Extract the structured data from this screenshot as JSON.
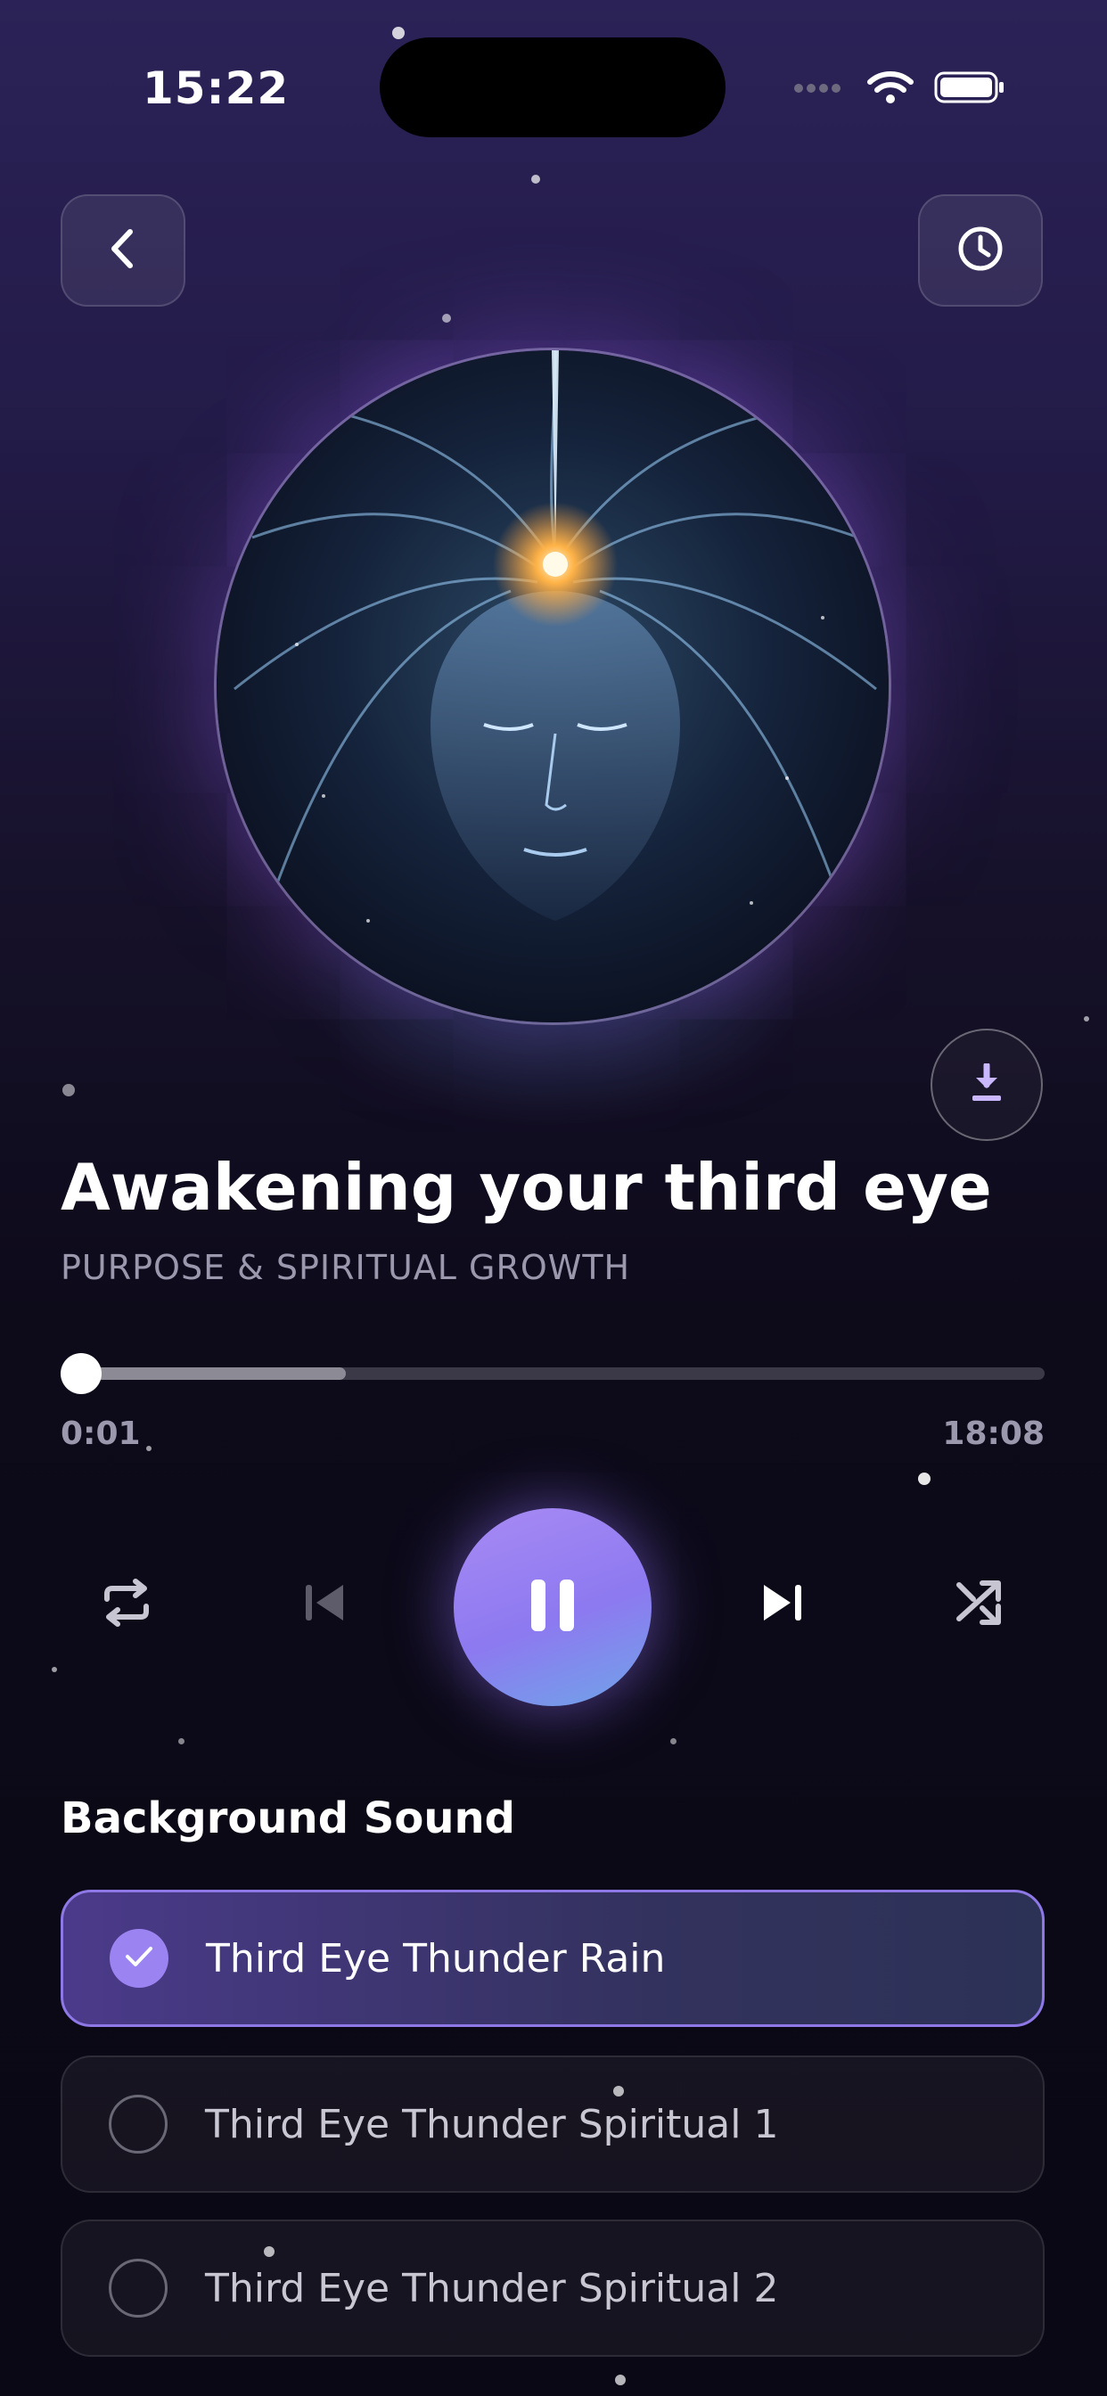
{
  "status_bar": {
    "time": "15:22"
  },
  "track": {
    "title": "Awakening your third eye",
    "category": "PURPOSE & SPIRITUAL GROWTH",
    "elapsed": "0:01",
    "duration": "18:08",
    "buffered_fraction": 0.29,
    "progress_fraction": 0.0
  },
  "background_sound": {
    "heading": "Background Sound",
    "options": [
      {
        "label": "Third Eye Thunder Rain",
        "selected": true
      },
      {
        "label": "Third Eye Thunder Spiritual 1",
        "selected": false
      },
      {
        "label": "Third Eye Thunder Spiritual 2",
        "selected": false
      }
    ]
  },
  "icons": {
    "back": "chevron-left-icon",
    "timer": "clock-icon",
    "download": "download-icon",
    "repeat": "repeat-icon",
    "previous": "skip-previous-icon",
    "play_state": "pause-icon",
    "next": "skip-next-icon",
    "shuffle": "shuffle-icon"
  },
  "colors": {
    "accent": "#9b84f2",
    "play_gradient_start": "#a88bf4",
    "play_gradient_end": "#6fa4e8",
    "selected_border": "#8e78e6"
  }
}
